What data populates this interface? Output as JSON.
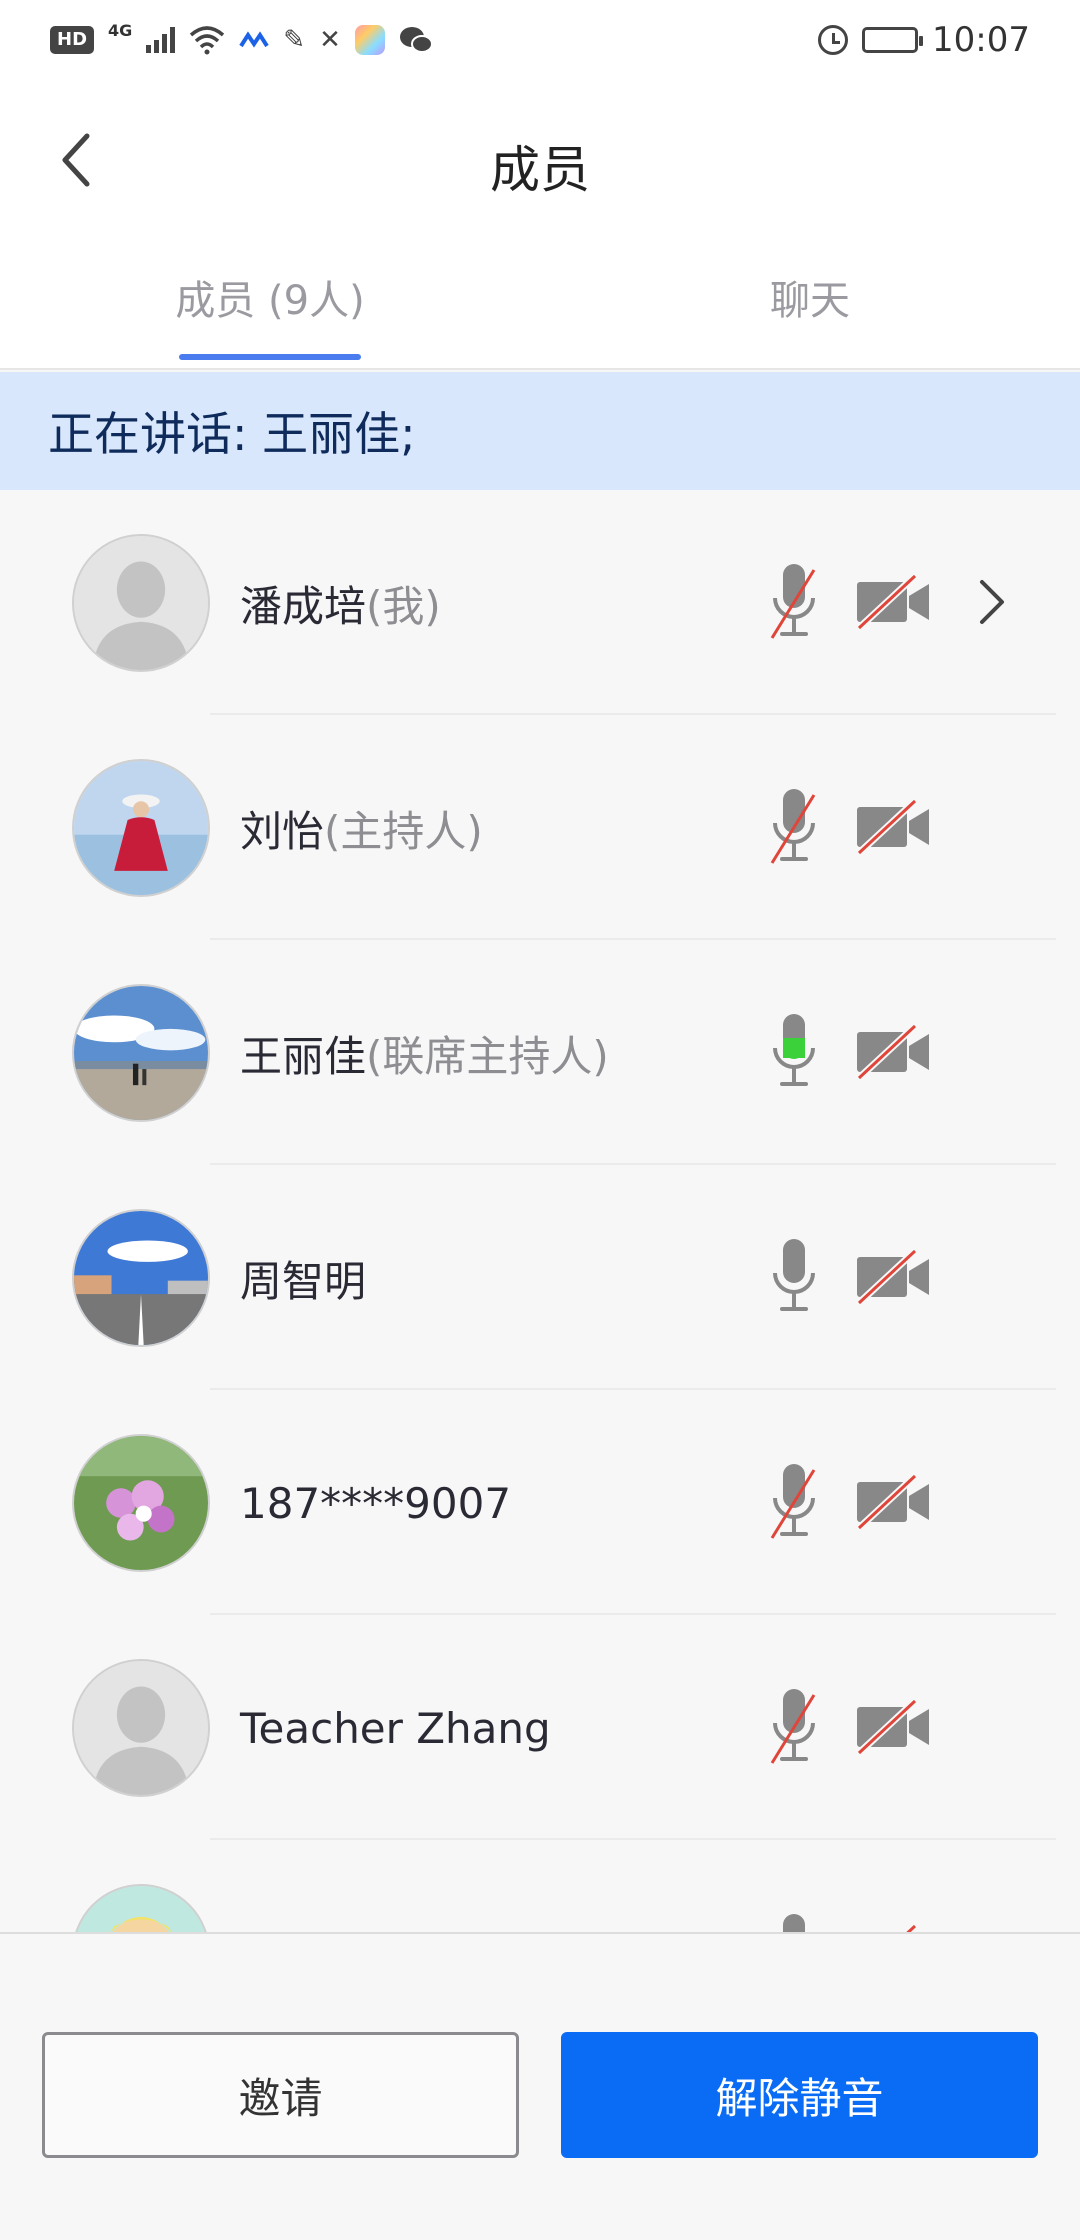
{
  "status_bar": {
    "left_badge": "HD",
    "network": "4G",
    "time": "10:07"
  },
  "header": {
    "title": "成员"
  },
  "tabs": [
    {
      "label": "成员 (9人)",
      "active": true
    },
    {
      "label": "聊天",
      "active": false
    }
  ],
  "speaking_banner": "正在讲话: 王丽佳;",
  "members": [
    {
      "name": "潘成培",
      "role": "(我)",
      "avatar": "default-avatar",
      "mic": "muted",
      "camera": "off",
      "has_chevron": true
    },
    {
      "name": "刘怡",
      "role": "(主持人)",
      "avatar": "photo-woman-red-dress",
      "mic": "muted",
      "camera": "off",
      "has_chevron": false
    },
    {
      "name": "王丽佳",
      "role": "(联席主持人)",
      "avatar": "photo-beach-sky",
      "mic": "speaking",
      "camera": "off",
      "has_chevron": false
    },
    {
      "name": "周智明",
      "role": "",
      "avatar": "photo-street",
      "mic": "on",
      "camera": "off",
      "has_chevron": false
    },
    {
      "name": "187****9007",
      "role": "",
      "avatar": "photo-flowers",
      "mic": "muted",
      "camera": "off",
      "has_chevron": false
    },
    {
      "name": "Teacher Zhang",
      "role": "",
      "avatar": "default-avatar",
      "mic": "muted",
      "camera": "off",
      "has_chevron": false
    },
    {
      "name": "",
      "role": "",
      "avatar": "photo-cartoon",
      "mic": "on",
      "camera": "off",
      "has_chevron": false
    }
  ],
  "buttons": {
    "invite": "邀请",
    "unmute": "解除静音"
  },
  "colors": {
    "accent": "#0a6cf5",
    "tab_indicator": "#4a7cf0",
    "banner_bg": "#d8e7fb",
    "muted_slash": "#e0453a",
    "speaking_green": "#3ad13a"
  }
}
